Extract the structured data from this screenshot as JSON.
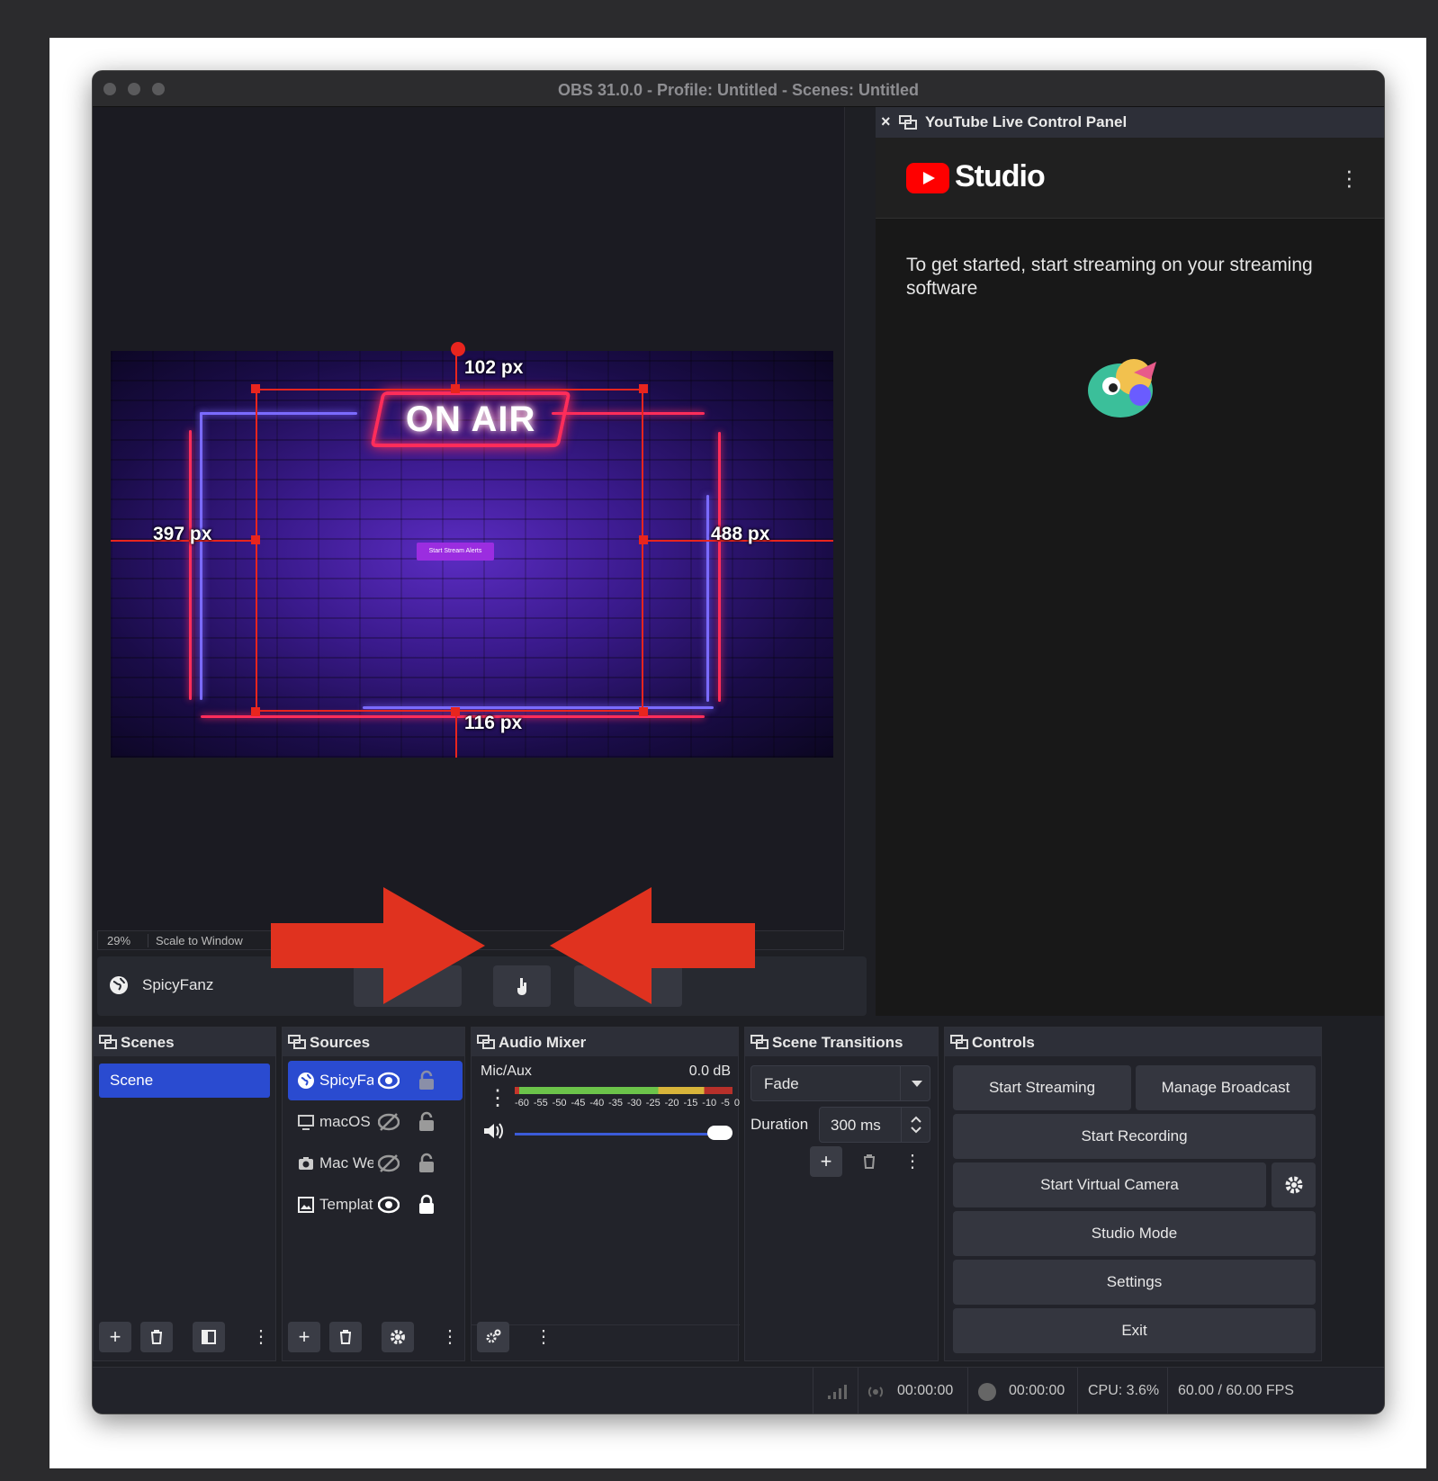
{
  "window": {
    "title": "OBS 31.0.0 - Profile: Untitled - Scenes: Untitled"
  },
  "preview": {
    "overlay_text": "ON AIR",
    "alert_button": "Start Stream Alerts",
    "measure_top": "102 px",
    "measure_left": "397 px",
    "measure_right": "488 px",
    "measure_bottom": "116 px",
    "zoom": "29%",
    "scale_mode": "Scale to Window",
    "source_name": "SpicyFanz"
  },
  "youtube_dock": {
    "title": "YouTube Live Control Panel",
    "close": "×",
    "brand": "Studio",
    "message": "To get started, start streaming on your streaming software"
  },
  "scenes": {
    "title": "Scenes",
    "items": [
      "Scene"
    ]
  },
  "sources": {
    "title": "Sources",
    "items": [
      {
        "name": "SpicyFanz",
        "visible": true,
        "locked": false
      },
      {
        "name": "macOS Screen Capture",
        "visible": false,
        "locked": false
      },
      {
        "name": "Mac Webcam",
        "visible": false,
        "locked": false
      },
      {
        "name": "Template",
        "visible": true,
        "locked": true
      }
    ]
  },
  "audio_mixer": {
    "title": "Audio Mixer",
    "channel": "Mic/Aux",
    "level": "0.0 dB",
    "ticks": [
      "-60",
      "-55",
      "-50",
      "-45",
      "-40",
      "-35",
      "-30",
      "-25",
      "-20",
      "-15",
      "-10",
      "-5",
      "0"
    ],
    "volume_fraction": 1.0
  },
  "transitions": {
    "title": "Scene Transitions",
    "selected": "Fade",
    "duration_label": "Duration",
    "duration_value": "300 ms"
  },
  "controls": {
    "title": "Controls",
    "start_streaming": "Start Streaming",
    "manage_broadcast": "Manage Broadcast",
    "start_recording": "Start Recording",
    "start_virtual_camera": "Start Virtual Camera",
    "studio_mode": "Studio Mode",
    "settings": "Settings",
    "exit": "Exit"
  },
  "status": {
    "stream_time": "00:00:00",
    "record_time": "00:00:00",
    "cpu": "CPU: 3.6%",
    "fps": "60.00 / 60.00 FPS"
  },
  "colors": {
    "accent": "#2a4bd0",
    "guide": "#e8251e",
    "arrow": "#e0321f",
    "youtube_red": "#ff0000"
  }
}
